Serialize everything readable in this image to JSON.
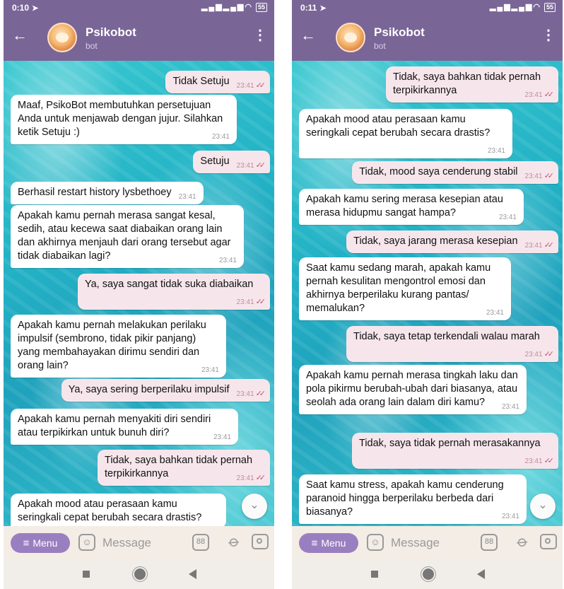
{
  "left": {
    "status": {
      "time": "0:10",
      "battery": "55"
    },
    "header": {
      "name": "Psikobot",
      "subtitle": "bot"
    },
    "messages": [
      {
        "text": "Tidak Setuju",
        "time": "23:41"
      },
      {
        "text": "Maaf, PsikoBot membutuhkan persetujuan Anda untuk menjawab dengan jujur. Silahkan ketik Setuju :)",
        "time": "23:41"
      },
      {
        "text": "Setuju",
        "time": "23:41"
      },
      {
        "text": "Berhasil restart history lysbethoey",
        "time": "23:41"
      },
      {
        "text": "Apakah kamu pernah merasa sangat kesal, sedih, atau kecewa saat diabaikan orang lain dan akhirnya menjauh dari orang tersebut agar tidak diabaikan lagi?",
        "time": "23:41"
      },
      {
        "text": "Ya, saya sangat tidak suka diabaikan",
        "time": "23:41"
      },
      {
        "text": "Apakah kamu pernah melakukan perilaku impulsif (sembrono, tidak pikir panjang) yang membahayakan dirimu sendiri dan orang lain?",
        "time": "23:41"
      },
      {
        "text": "Ya, saya sering berperilaku impulsif",
        "time": "23:41"
      },
      {
        "text": "Apakah kamu pernah menyakiti diri sendiri atau terpikirkan untuk bunuh diri?",
        "time": "23:41"
      },
      {
        "text": "Tidak, saya bahkan tidak pernah terpikirkannya",
        "time": "23:41"
      },
      {
        "text": "Apakah mood atau perasaan kamu seringkali cepat berubah secara drastis?",
        "time": ""
      }
    ],
    "input": {
      "menu_label": "Menu",
      "placeholder": "Message"
    }
  },
  "right": {
    "status": {
      "time": "0:11",
      "battery": "55"
    },
    "header": {
      "name": "Psikobot",
      "subtitle": "bot"
    },
    "messages": [
      {
        "text": "Tidak, saya bahkan tidak pernah terpikirkannya",
        "time": "23:41"
      },
      {
        "text": "Apakah mood atau perasaan kamu seringkali cepat berubah secara drastis?",
        "time": "23:41"
      },
      {
        "text": "Tidak, mood saya cenderung stabil",
        "time": "23:41"
      },
      {
        "text": "Apakah kamu sering merasa kesepian atau merasa hidupmu sangat hampa?",
        "time": "23:41"
      },
      {
        "text": "Tidak, saya jarang merasa kesepian",
        "time": "23:41"
      },
      {
        "text": "Saat kamu sedang marah, apakah kamu pernah kesulitan mengontrol emosi dan akhirnya berperilaku kurang pantas/ memalukan?",
        "time": "23:41"
      },
      {
        "text": "Tidak, saya tetap terkendali walau marah",
        "time": "23:41"
      },
      {
        "text": "Apakah kamu pernah merasa tingkah laku dan pola pikirmu berubah-ubah dari biasanya, atau seolah ada orang lain dalam diri kamu?",
        "time": "23:41"
      },
      {
        "text": "Tidak, saya tidak pernah merasakannya",
        "time": "23:41"
      },
      {
        "text": "Saat kamu stress, apakah kamu cenderung paranoid hingga berperilaku berbeda dari biasanya?",
        "time": "23:41"
      }
    ],
    "input": {
      "menu_label": "Menu",
      "placeholder": "Message"
    }
  },
  "icons": {
    "back": "arrow-left",
    "more": "vertical-ellipsis",
    "emoji": "sticker-face",
    "commands": "grid-88",
    "attach": "paperclip",
    "camera": "camera",
    "scroll": "chevron-down",
    "nav_recent": "square",
    "nav_home": "circle",
    "nav_back": "triangle-left"
  },
  "colors": {
    "header": "#7a6597",
    "menu_button": "#9a7fc0",
    "outgoing_bubble": "#f6e6ec",
    "incoming_bubble": "#ffffff",
    "read_ticks": "#c2506e"
  }
}
